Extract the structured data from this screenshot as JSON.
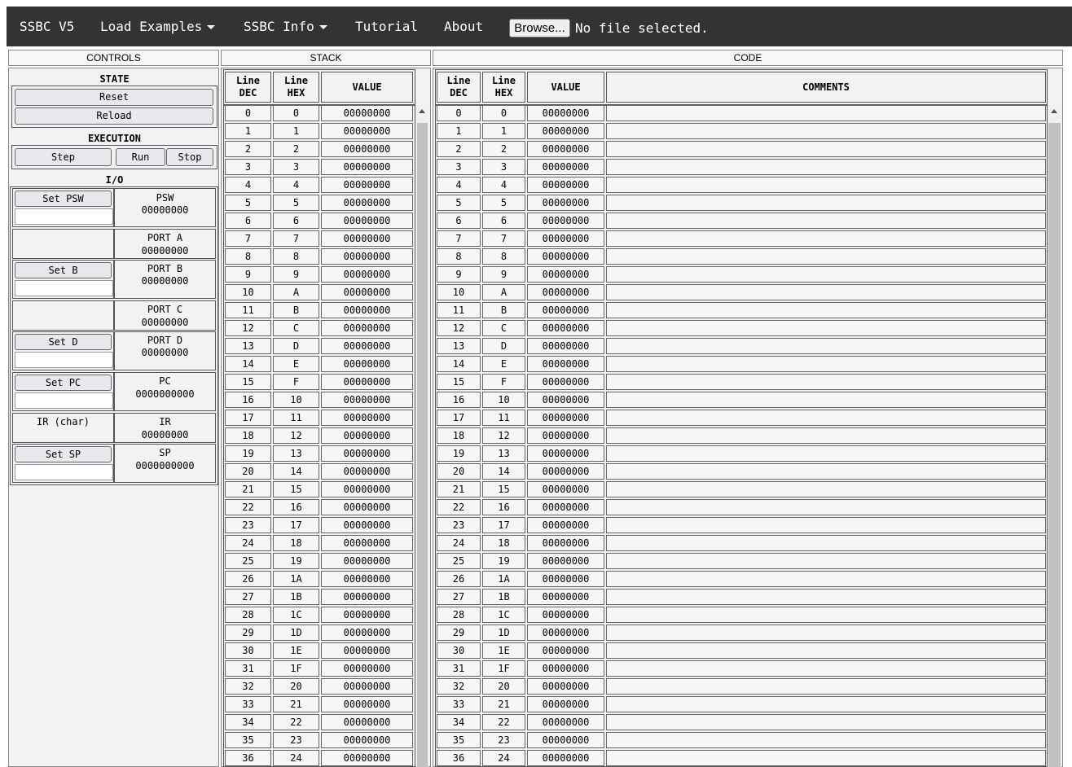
{
  "navbar": {
    "title": "SSBC V5",
    "load_examples": "Load Examples",
    "ssbc_info": "SSBC Info",
    "tutorial": "Tutorial",
    "about": "About",
    "browse_label": "Browse...",
    "file_status": "No file selected."
  },
  "panels": {
    "controls": "CONTROLS",
    "stack": "STACK",
    "code": "CODE"
  },
  "controls": {
    "state_title": "STATE",
    "reset": "Reset",
    "reload": "Reload",
    "execution_title": "EXECUTION",
    "step": "Step",
    "run": "Run",
    "stop": "Stop",
    "io_title": "I/O",
    "set_psw": "Set PSW",
    "psw_label": "PSW",
    "psw_value": "00000000",
    "port_a_label": "PORT A",
    "port_a_value": "00000000",
    "set_b": "Set B",
    "port_b_label": "PORT B",
    "port_b_value": "00000000",
    "port_c_label": "PORT C",
    "port_c_value": "00000000",
    "set_d": "Set D",
    "port_d_label": "PORT D",
    "port_d_value": "00000000",
    "set_pc": "Set PC",
    "pc_label": "PC",
    "pc_value": "0000000000",
    "ir_char": "IR (char)",
    "ir_label": "IR",
    "ir_value": "00000000",
    "set_sp": "Set SP",
    "sp_label": "SP",
    "sp_value": "0000000000"
  },
  "stack": {
    "headers": {
      "line_dec_1": "Line",
      "line_dec_2": "DEC",
      "line_hex_1": "Line",
      "line_hex_2": "HEX",
      "value": "VALUE"
    },
    "rows": [
      [
        "0",
        "0",
        "00000000"
      ],
      [
        "1",
        "1",
        "00000000"
      ],
      [
        "2",
        "2",
        "00000000"
      ],
      [
        "3",
        "3",
        "00000000"
      ],
      [
        "4",
        "4",
        "00000000"
      ],
      [
        "5",
        "5",
        "00000000"
      ],
      [
        "6",
        "6",
        "00000000"
      ],
      [
        "7",
        "7",
        "00000000"
      ],
      [
        "8",
        "8",
        "00000000"
      ],
      [
        "9",
        "9",
        "00000000"
      ],
      [
        "10",
        "A",
        "00000000"
      ],
      [
        "11",
        "B",
        "00000000"
      ],
      [
        "12",
        "C",
        "00000000"
      ],
      [
        "13",
        "D",
        "00000000"
      ],
      [
        "14",
        "E",
        "00000000"
      ],
      [
        "15",
        "F",
        "00000000"
      ],
      [
        "16",
        "10",
        "00000000"
      ],
      [
        "17",
        "11",
        "00000000"
      ],
      [
        "18",
        "12",
        "00000000"
      ],
      [
        "19",
        "13",
        "00000000"
      ],
      [
        "20",
        "14",
        "00000000"
      ],
      [
        "21",
        "15",
        "00000000"
      ],
      [
        "22",
        "16",
        "00000000"
      ],
      [
        "23",
        "17",
        "00000000"
      ],
      [
        "24",
        "18",
        "00000000"
      ],
      [
        "25",
        "19",
        "00000000"
      ],
      [
        "26",
        "1A",
        "00000000"
      ],
      [
        "27",
        "1B",
        "00000000"
      ],
      [
        "28",
        "1C",
        "00000000"
      ],
      [
        "29",
        "1D",
        "00000000"
      ],
      [
        "30",
        "1E",
        "00000000"
      ],
      [
        "31",
        "1F",
        "00000000"
      ],
      [
        "32",
        "20",
        "00000000"
      ],
      [
        "33",
        "21",
        "00000000"
      ],
      [
        "34",
        "22",
        "00000000"
      ],
      [
        "35",
        "23",
        "00000000"
      ],
      [
        "36",
        "24",
        "00000000"
      ]
    ]
  },
  "code": {
    "headers": {
      "line_dec_1": "Line",
      "line_dec_2": "DEC",
      "line_hex_1": "Line",
      "line_hex_2": "HEX",
      "value": "VALUE",
      "comments": "COMMENTS"
    },
    "rows": [
      [
        "0",
        "0",
        "00000000",
        ""
      ],
      [
        "1",
        "1",
        "00000000",
        ""
      ],
      [
        "2",
        "2",
        "00000000",
        ""
      ],
      [
        "3",
        "3",
        "00000000",
        ""
      ],
      [
        "4",
        "4",
        "00000000",
        ""
      ],
      [
        "5",
        "5",
        "00000000",
        ""
      ],
      [
        "6",
        "6",
        "00000000",
        ""
      ],
      [
        "7",
        "7",
        "00000000",
        ""
      ],
      [
        "8",
        "8",
        "00000000",
        ""
      ],
      [
        "9",
        "9",
        "00000000",
        ""
      ],
      [
        "10",
        "A",
        "00000000",
        ""
      ],
      [
        "11",
        "B",
        "00000000",
        ""
      ],
      [
        "12",
        "C",
        "00000000",
        ""
      ],
      [
        "13",
        "D",
        "00000000",
        ""
      ],
      [
        "14",
        "E",
        "00000000",
        ""
      ],
      [
        "15",
        "F",
        "00000000",
        ""
      ],
      [
        "16",
        "10",
        "00000000",
        ""
      ],
      [
        "17",
        "11",
        "00000000",
        ""
      ],
      [
        "18",
        "12",
        "00000000",
        ""
      ],
      [
        "19",
        "13",
        "00000000",
        ""
      ],
      [
        "20",
        "14",
        "00000000",
        ""
      ],
      [
        "21",
        "15",
        "00000000",
        ""
      ],
      [
        "22",
        "16",
        "00000000",
        ""
      ],
      [
        "23",
        "17",
        "00000000",
        ""
      ],
      [
        "24",
        "18",
        "00000000",
        ""
      ],
      [
        "25",
        "19",
        "00000000",
        ""
      ],
      [
        "26",
        "1A",
        "00000000",
        ""
      ],
      [
        "27",
        "1B",
        "00000000",
        ""
      ],
      [
        "28",
        "1C",
        "00000000",
        ""
      ],
      [
        "29",
        "1D",
        "00000000",
        ""
      ],
      [
        "30",
        "1E",
        "00000000",
        ""
      ],
      [
        "31",
        "1F",
        "00000000",
        ""
      ],
      [
        "32",
        "20",
        "00000000",
        ""
      ],
      [
        "33",
        "21",
        "00000000",
        ""
      ],
      [
        "34",
        "22",
        "00000000",
        ""
      ],
      [
        "35",
        "23",
        "00000000",
        ""
      ],
      [
        "36",
        "24",
        "00000000",
        ""
      ]
    ]
  },
  "colors": {
    "navbar_bg": "#333333",
    "panel_bg": "#f2f2f2",
    "scroll_thumb": "#c1c1c1"
  }
}
